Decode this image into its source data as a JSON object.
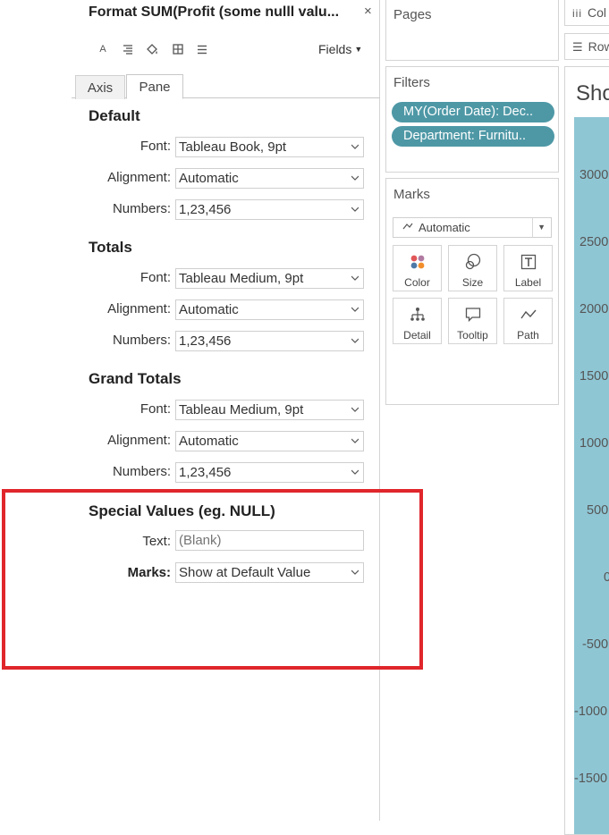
{
  "format_pane": {
    "title": "Format SUM(Profit (some nulll valu...",
    "close": "×",
    "fields_label": "Fields",
    "tabs": [
      "Axis",
      "Pane"
    ],
    "active_tab": "Pane",
    "sections": {
      "default": {
        "title": "Default",
        "font_label": "Font:",
        "font_value": "Tableau Book, 9pt",
        "alignment_label": "Alignment:",
        "alignment_value": "Automatic",
        "numbers_label": "Numbers:",
        "numbers_value": "1,23,456"
      },
      "totals": {
        "title": "Totals",
        "font_label": "Font:",
        "font_value": "Tableau Medium, 9pt",
        "alignment_label": "Alignment:",
        "alignment_value": "Automatic",
        "numbers_label": "Numbers:",
        "numbers_value": "1,23,456"
      },
      "grand_totals": {
        "title": "Grand Totals",
        "font_label": "Font:",
        "font_value": "Tableau Medium, 9pt",
        "alignment_label": "Alignment:",
        "alignment_value": "Automatic",
        "numbers_label": "Numbers:",
        "numbers_value": "1,23,456"
      },
      "special_values": {
        "title": "Special Values (eg. NULL)",
        "text_label": "Text:",
        "text_placeholder": "(Blank)",
        "marks_label": "Marks:",
        "marks_value": "Show at Default Value"
      }
    }
  },
  "pages": {
    "title": "Pages"
  },
  "filters": {
    "title": "Filters",
    "pills": [
      "MY(Order Date): Dec..",
      "Department: Furnitu.."
    ]
  },
  "marks": {
    "title": "Marks",
    "type": "Automatic",
    "buttons": [
      "Color",
      "Size",
      "Label",
      "Detail",
      "Tooltip",
      "Path"
    ]
  },
  "shelves": {
    "columns": "Col",
    "rows": "Row"
  },
  "view": {
    "title": "Sho",
    "y_ticks": [
      "3000",
      "2500",
      "2000",
      "1500",
      "1000",
      "500",
      "0",
      "-500",
      "-1000",
      "-1500"
    ]
  },
  "colors": {
    "pill": "#4e98a6",
    "bar": "#8fc6d4",
    "highlight": "#e0262b"
  }
}
